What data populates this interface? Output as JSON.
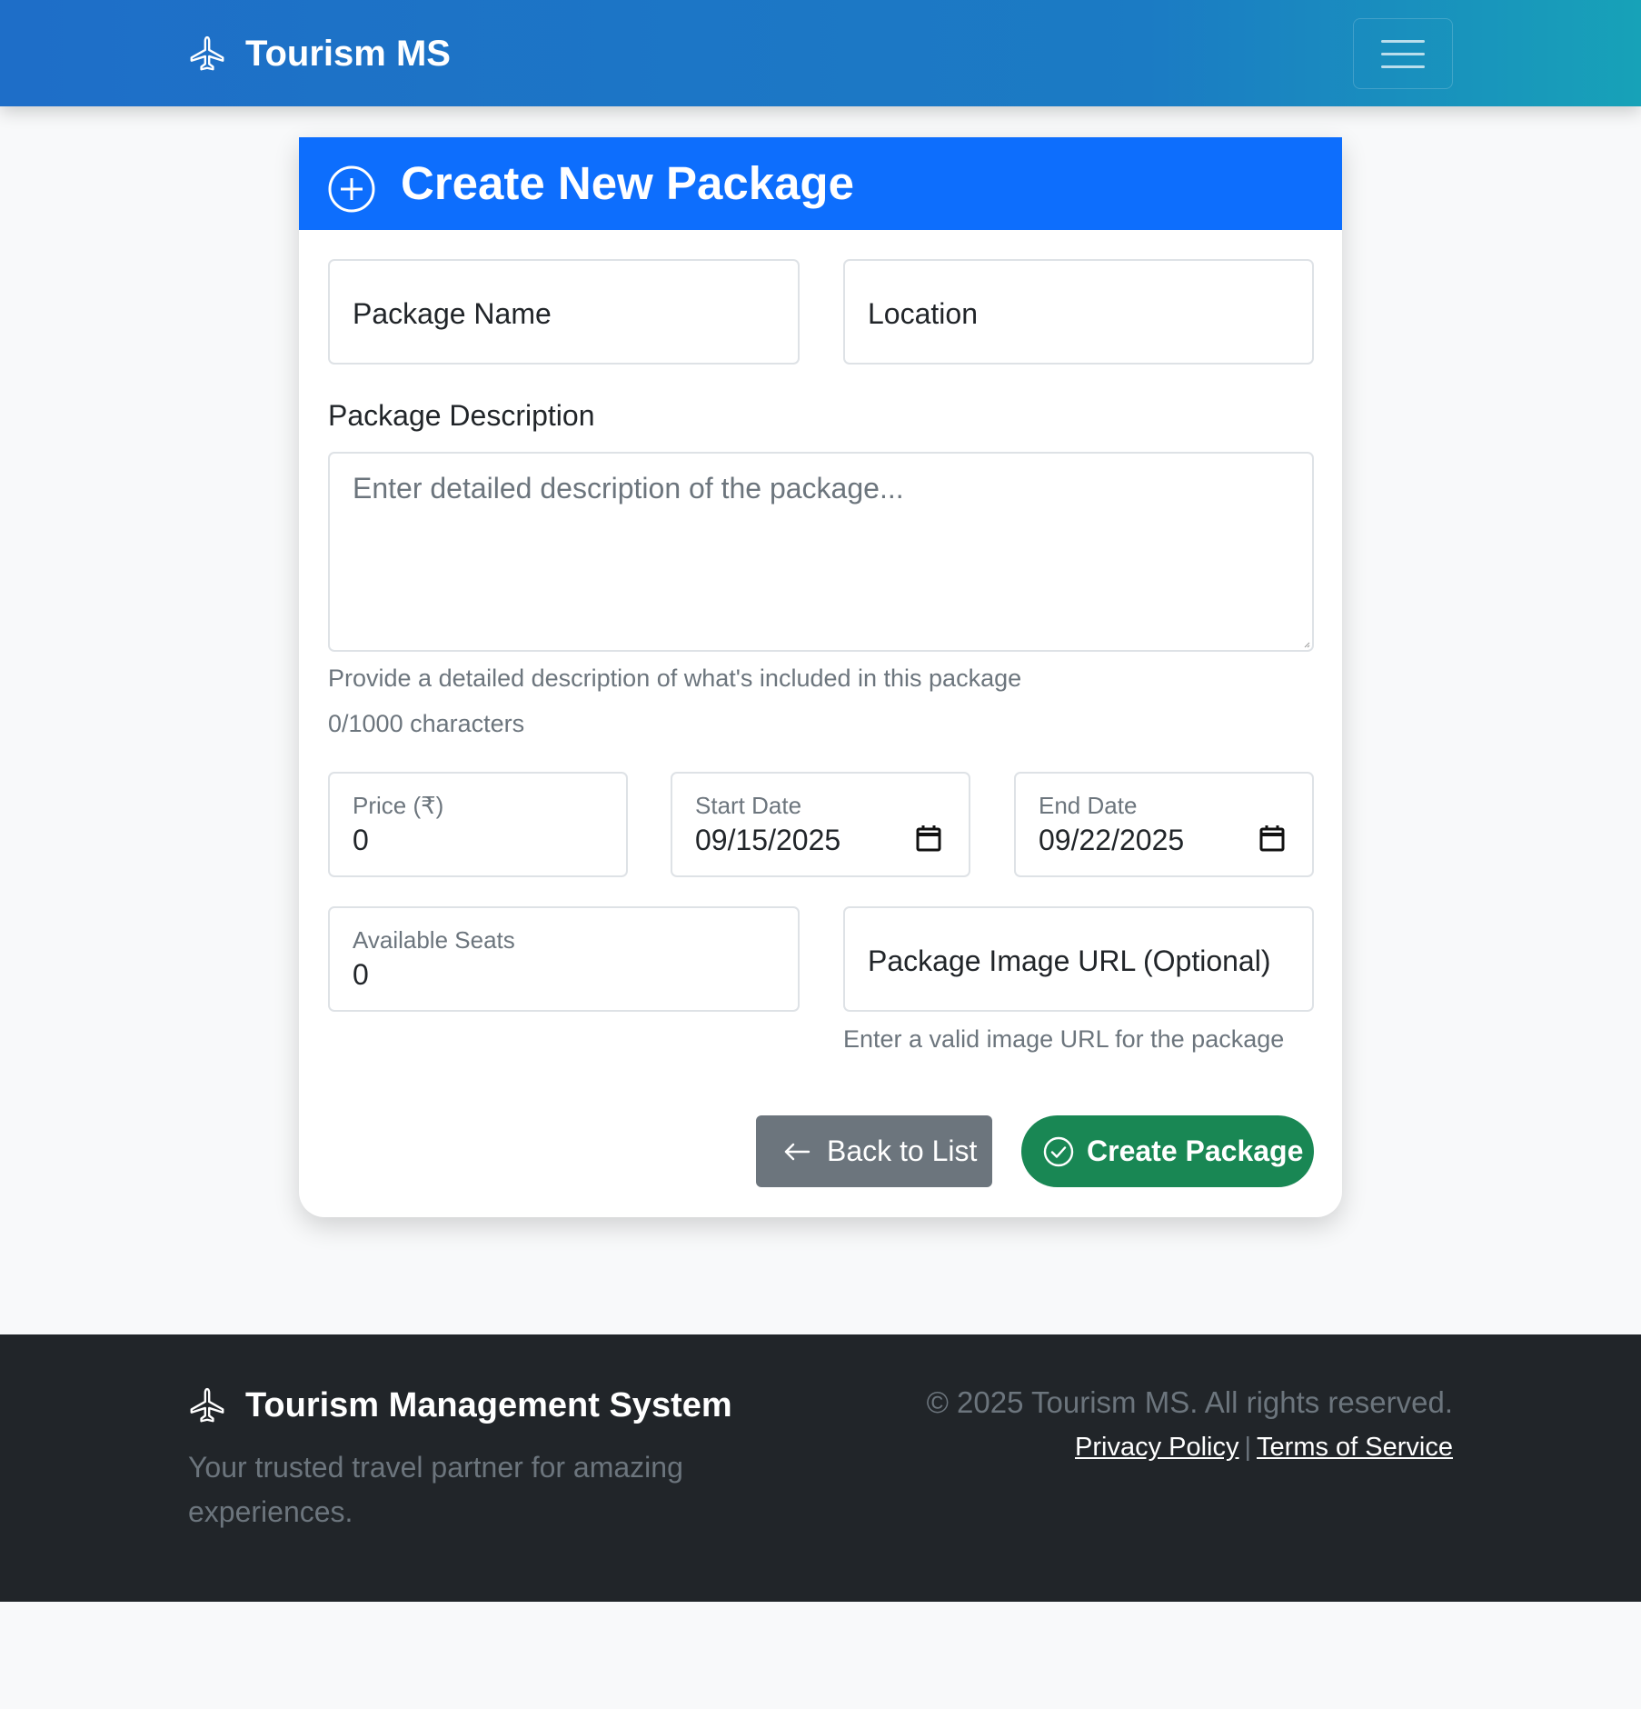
{
  "navbar": {
    "brand": "Tourism MS",
    "brand_icon": "airplane-icon",
    "toggler_icon": "hamburger-menu-icon"
  },
  "card": {
    "title": "Create New Package",
    "title_icon": "plus-circle-icon",
    "fields": {
      "package_name": {
        "placeholder": "Package Name",
        "value": ""
      },
      "location": {
        "placeholder": "Location",
        "value": ""
      },
      "description": {
        "label": "Package Description",
        "placeholder": "Enter detailed description of the package...",
        "help": "Provide a detailed description of what's included in this package",
        "counter": "0/1000 characters"
      },
      "price": {
        "label": "Price (₹)",
        "value": "0"
      },
      "start_date": {
        "label": "Start Date",
        "value": "09/15/2025"
      },
      "end_date": {
        "label": "End Date",
        "value": "09/22/2025"
      },
      "available_seats": {
        "label": "Available Seats",
        "value": "0"
      },
      "image_url": {
        "placeholder": "Package Image URL (Optional)",
        "help": "Enter a valid image URL for the package"
      }
    },
    "buttons": {
      "back": "Back to List",
      "create": "Create Package"
    }
  },
  "footer": {
    "brand": "Tourism Management System",
    "tagline": "Your trusted travel partner for amazing experiences.",
    "copyright": "© 2025 Tourism MS. All rights reserved.",
    "links": {
      "privacy": "Privacy Policy",
      "separator": "|",
      "terms": "Terms of Service"
    }
  },
  "colors": {
    "navbar_gradient_start": "#1e6ec8",
    "navbar_gradient_end": "#17a2b8",
    "card_header": "#0d6efd",
    "back_button": "#6c757d",
    "create_button": "#198754",
    "footer_bg": "#212529",
    "page_bg": "#f8f9fa"
  }
}
